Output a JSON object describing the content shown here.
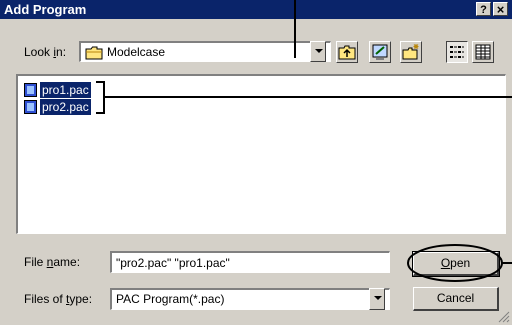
{
  "window": {
    "title": "Add Program",
    "help_glyph": "?",
    "close_glyph": "×"
  },
  "lookin": {
    "label_pre": "Look ",
    "label_accel": "i",
    "label_post": "n:",
    "value": "Modelcase",
    "icon": "folder-icon"
  },
  "toolbar": {
    "icons": [
      "up-one-level-icon",
      "desktop-icon",
      "new-folder-icon",
      "list-view-icon",
      "details-view-icon"
    ]
  },
  "files": [
    {
      "name": "pro1.pac",
      "icon": "pac-file-icon",
      "selected": true
    },
    {
      "name": "pro2.pac",
      "icon": "pac-file-icon",
      "selected": true
    }
  ],
  "filename": {
    "label_pre": "File ",
    "label_accel": "n",
    "label_post": "ame:",
    "value": "\"pro2.pac\" \"pro1.pac\""
  },
  "filetype": {
    "label_pre": "Files of ",
    "label_accel": "t",
    "label_post": "ype:",
    "value": "PAC Program(*.pac)"
  },
  "buttons": {
    "open_accel": "O",
    "open_rest": "pen",
    "cancel": "Cancel"
  },
  "colors": {
    "titlebar": "#0a246a",
    "face": "#d4d0c8",
    "selection": "#0a246a"
  }
}
